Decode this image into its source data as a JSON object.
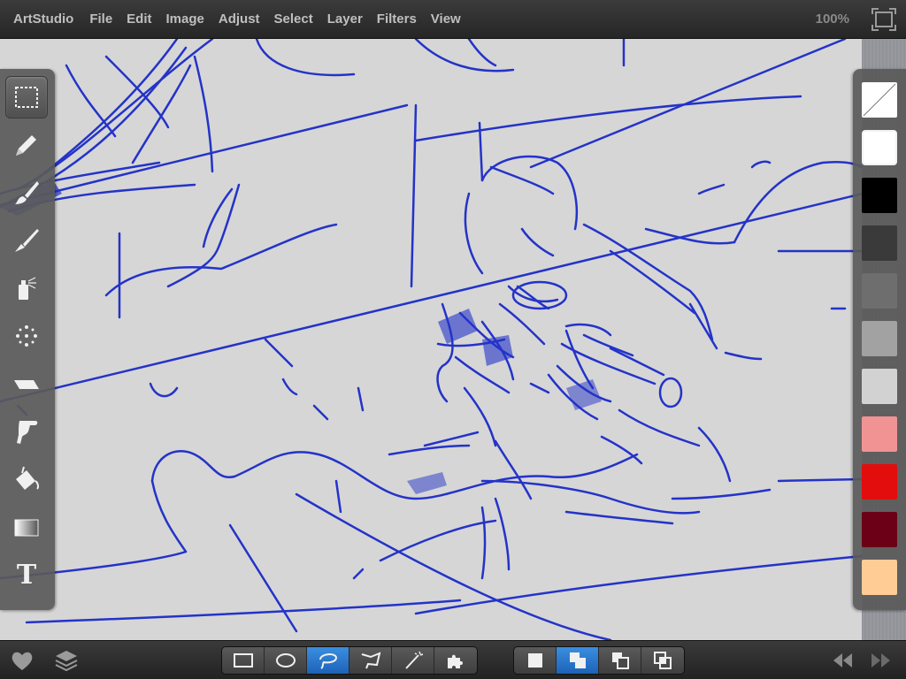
{
  "menubar": {
    "app_name": "ArtStudio",
    "items": [
      "File",
      "Edit",
      "Image",
      "Adjust",
      "Select",
      "Layer",
      "Filters",
      "View"
    ],
    "zoom": "100%",
    "fullscreen_icon": "fullscreen-icon"
  },
  "tools": [
    {
      "name": "rectangle-select-tool",
      "icon": "marquee-icon",
      "active": true
    },
    {
      "name": "pencil-tool",
      "icon": "pencil-icon",
      "active": false
    },
    {
      "name": "brush-tool",
      "icon": "brush-icon",
      "active": false
    },
    {
      "name": "smudge-tool",
      "icon": "smudge-brush-icon",
      "active": false
    },
    {
      "name": "spray-tool",
      "icon": "spray-can-icon",
      "active": false
    },
    {
      "name": "scatter-tool",
      "icon": "dots-icon",
      "active": false
    },
    {
      "name": "eraser-tool",
      "icon": "eraser-icon",
      "active": false
    },
    {
      "name": "finger-smudge-tool",
      "icon": "finger-icon",
      "active": false
    },
    {
      "name": "fill-tool",
      "icon": "paint-bucket-icon",
      "active": false
    },
    {
      "name": "gradient-tool",
      "icon": "gradient-icon",
      "active": false
    },
    {
      "name": "text-tool",
      "icon": "text-icon",
      "glyph": "T",
      "active": false
    }
  ],
  "colors": {
    "swatches": [
      "transparent",
      "#ffffff",
      "#000000",
      "#3a3a3a",
      "#6e6e6e",
      "#a2a2a2",
      "#d2d2d2",
      "#f19393",
      "#e30d0d",
      "#6c0016",
      "#ffcc96"
    ],
    "selected_index": 1
  },
  "canvas": {
    "stroke_color": "#2433c8",
    "background": "#d6d6d6"
  },
  "bottombar": {
    "left_icons": [
      "heart-icon",
      "layers-icon"
    ],
    "selection_shapes": [
      {
        "name": "rect-select-shape",
        "icon": "rectangle-icon",
        "active": false
      },
      {
        "name": "ellipse-select-shape",
        "icon": "ellipse-icon",
        "active": false
      },
      {
        "name": "lasso-select-shape",
        "icon": "lasso-icon",
        "active": true
      },
      {
        "name": "polygon-select-shape",
        "icon": "polygon-lasso-icon",
        "active": false
      },
      {
        "name": "magic-wand-select",
        "icon": "magic-wand-icon",
        "active": false
      },
      {
        "name": "puzzle-select",
        "icon": "puzzle-icon",
        "active": false
      }
    ],
    "selection_modes": [
      {
        "name": "mode-new",
        "icon": "new-selection-icon",
        "active": false
      },
      {
        "name": "mode-add",
        "icon": "add-selection-icon",
        "active": true
      },
      {
        "name": "mode-subtract",
        "icon": "subtract-selection-icon",
        "active": false
      },
      {
        "name": "mode-intersect",
        "icon": "intersect-selection-icon",
        "active": false
      }
    ],
    "right_icons": [
      "rewind-icon",
      "forward-icon"
    ]
  }
}
